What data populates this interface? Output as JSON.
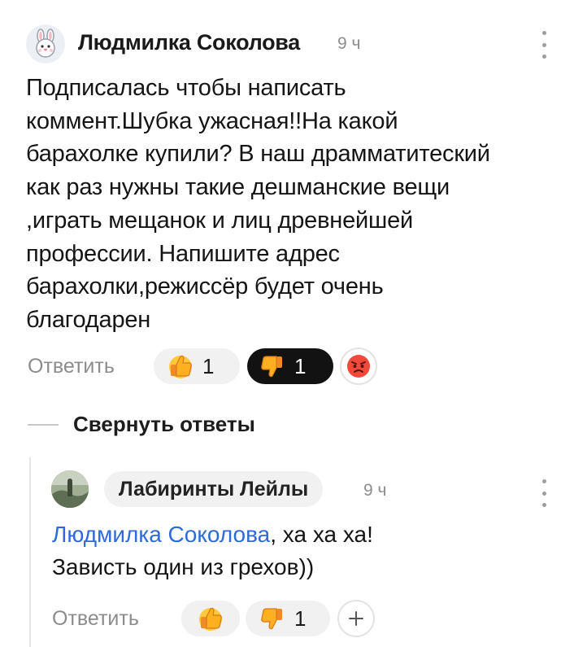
{
  "comment": {
    "author": "Людмилка Соколова",
    "time": "9 ч",
    "avatar_icon": "bunny-avatar-icon",
    "text": "Подписалась чтобы написать\nкоммент.Шубка ужасная!!На какой\nбарахолке купили? В наш драмматитеский\nкак раз нужны такие дешманские вещи\n,играть мещанок и лиц древнейшей\nпрофессии. Напишите адрес\nбарахолки,режиссёр будет очень\nблагодарен",
    "reply_label": "Ответить",
    "likes": "1",
    "dislikes": "1",
    "extra_reaction_icon": "angry-face-icon"
  },
  "collapse_label": "Свернуть ответы",
  "reply": {
    "author": "Лабиринты Лейлы",
    "time": "9 ч",
    "mention": "Людмилка Соколова",
    "text_after_mention": ", ха ха ха!",
    "text_line2": "Зависть один из грехов))",
    "reply_label": "Ответить",
    "dislikes": "1",
    "add_reaction_icon": "plus-icon"
  },
  "colors": {
    "accent_link": "#2f6bd6",
    "dislike_active_bg": "#121212",
    "reaction_bg": "#f1f1f1"
  }
}
